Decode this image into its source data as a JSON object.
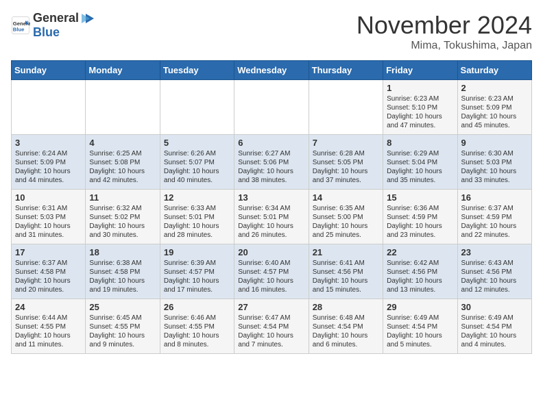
{
  "header": {
    "logo_line1": "General",
    "logo_line2": "Blue",
    "month": "November 2024",
    "location": "Mima, Tokushima, Japan"
  },
  "weekdays": [
    "Sunday",
    "Monday",
    "Tuesday",
    "Wednesday",
    "Thursday",
    "Friday",
    "Saturday"
  ],
  "weeks": [
    [
      {
        "day": "",
        "info": ""
      },
      {
        "day": "",
        "info": ""
      },
      {
        "day": "",
        "info": ""
      },
      {
        "day": "",
        "info": ""
      },
      {
        "day": "",
        "info": ""
      },
      {
        "day": "1",
        "info": "Sunrise: 6:23 AM\nSunset: 5:10 PM\nDaylight: 10 hours and 47 minutes."
      },
      {
        "day": "2",
        "info": "Sunrise: 6:23 AM\nSunset: 5:09 PM\nDaylight: 10 hours and 45 minutes."
      }
    ],
    [
      {
        "day": "3",
        "info": "Sunrise: 6:24 AM\nSunset: 5:09 PM\nDaylight: 10 hours and 44 minutes."
      },
      {
        "day": "4",
        "info": "Sunrise: 6:25 AM\nSunset: 5:08 PM\nDaylight: 10 hours and 42 minutes."
      },
      {
        "day": "5",
        "info": "Sunrise: 6:26 AM\nSunset: 5:07 PM\nDaylight: 10 hours and 40 minutes."
      },
      {
        "day": "6",
        "info": "Sunrise: 6:27 AM\nSunset: 5:06 PM\nDaylight: 10 hours and 38 minutes."
      },
      {
        "day": "7",
        "info": "Sunrise: 6:28 AM\nSunset: 5:05 PM\nDaylight: 10 hours and 37 minutes."
      },
      {
        "day": "8",
        "info": "Sunrise: 6:29 AM\nSunset: 5:04 PM\nDaylight: 10 hours and 35 minutes."
      },
      {
        "day": "9",
        "info": "Sunrise: 6:30 AM\nSunset: 5:03 PM\nDaylight: 10 hours and 33 minutes."
      }
    ],
    [
      {
        "day": "10",
        "info": "Sunrise: 6:31 AM\nSunset: 5:03 PM\nDaylight: 10 hours and 31 minutes."
      },
      {
        "day": "11",
        "info": "Sunrise: 6:32 AM\nSunset: 5:02 PM\nDaylight: 10 hours and 30 minutes."
      },
      {
        "day": "12",
        "info": "Sunrise: 6:33 AM\nSunset: 5:01 PM\nDaylight: 10 hours and 28 minutes."
      },
      {
        "day": "13",
        "info": "Sunrise: 6:34 AM\nSunset: 5:01 PM\nDaylight: 10 hours and 26 minutes."
      },
      {
        "day": "14",
        "info": "Sunrise: 6:35 AM\nSunset: 5:00 PM\nDaylight: 10 hours and 25 minutes."
      },
      {
        "day": "15",
        "info": "Sunrise: 6:36 AM\nSunset: 4:59 PM\nDaylight: 10 hours and 23 minutes."
      },
      {
        "day": "16",
        "info": "Sunrise: 6:37 AM\nSunset: 4:59 PM\nDaylight: 10 hours and 22 minutes."
      }
    ],
    [
      {
        "day": "17",
        "info": "Sunrise: 6:37 AM\nSunset: 4:58 PM\nDaylight: 10 hours and 20 minutes."
      },
      {
        "day": "18",
        "info": "Sunrise: 6:38 AM\nSunset: 4:58 PM\nDaylight: 10 hours and 19 minutes."
      },
      {
        "day": "19",
        "info": "Sunrise: 6:39 AM\nSunset: 4:57 PM\nDaylight: 10 hours and 17 minutes."
      },
      {
        "day": "20",
        "info": "Sunrise: 6:40 AM\nSunset: 4:57 PM\nDaylight: 10 hours and 16 minutes."
      },
      {
        "day": "21",
        "info": "Sunrise: 6:41 AM\nSunset: 4:56 PM\nDaylight: 10 hours and 15 minutes."
      },
      {
        "day": "22",
        "info": "Sunrise: 6:42 AM\nSunset: 4:56 PM\nDaylight: 10 hours and 13 minutes."
      },
      {
        "day": "23",
        "info": "Sunrise: 6:43 AM\nSunset: 4:56 PM\nDaylight: 10 hours and 12 minutes."
      }
    ],
    [
      {
        "day": "24",
        "info": "Sunrise: 6:44 AM\nSunset: 4:55 PM\nDaylight: 10 hours and 11 minutes."
      },
      {
        "day": "25",
        "info": "Sunrise: 6:45 AM\nSunset: 4:55 PM\nDaylight: 10 hours and 9 minutes."
      },
      {
        "day": "26",
        "info": "Sunrise: 6:46 AM\nSunset: 4:55 PM\nDaylight: 10 hours and 8 minutes."
      },
      {
        "day": "27",
        "info": "Sunrise: 6:47 AM\nSunset: 4:54 PM\nDaylight: 10 hours and 7 minutes."
      },
      {
        "day": "28",
        "info": "Sunrise: 6:48 AM\nSunset: 4:54 PM\nDaylight: 10 hours and 6 minutes."
      },
      {
        "day": "29",
        "info": "Sunrise: 6:49 AM\nSunset: 4:54 PM\nDaylight: 10 hours and 5 minutes."
      },
      {
        "day": "30",
        "info": "Sunrise: 6:49 AM\nSunset: 4:54 PM\nDaylight: 10 hours and 4 minutes."
      }
    ]
  ]
}
